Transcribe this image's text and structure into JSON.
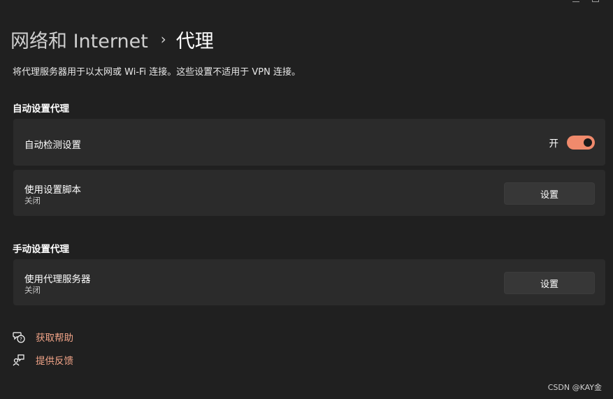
{
  "header": {
    "parent": "网络和 Internet",
    "separator": "›",
    "current": "代理"
  },
  "description": "将代理服务器用于以太网或 Wi-Fi 连接。这些设置不适用于 VPN 连接。",
  "auto_section": {
    "title": "自动设置代理",
    "detect": {
      "label": "自动检测设置",
      "toggle_label": "开",
      "toggle_on": true
    },
    "script": {
      "label": "使用设置脚本",
      "status": "关闭",
      "button": "设置"
    }
  },
  "manual_section": {
    "title": "手动设置代理",
    "proxy": {
      "label": "使用代理服务器",
      "status": "关闭",
      "button": "设置"
    }
  },
  "links": {
    "help": "获取帮助",
    "feedback": "提供反馈"
  },
  "watermark": "CSDN @KAY金",
  "colors": {
    "accent": "#f08a6c",
    "link": "#f2a488",
    "background": "#202020",
    "card": "#2b2b2b"
  },
  "icons": {
    "breadcrumb_separator": "chevron-right-icon",
    "help": "help-icon",
    "feedback": "feedback-icon"
  }
}
